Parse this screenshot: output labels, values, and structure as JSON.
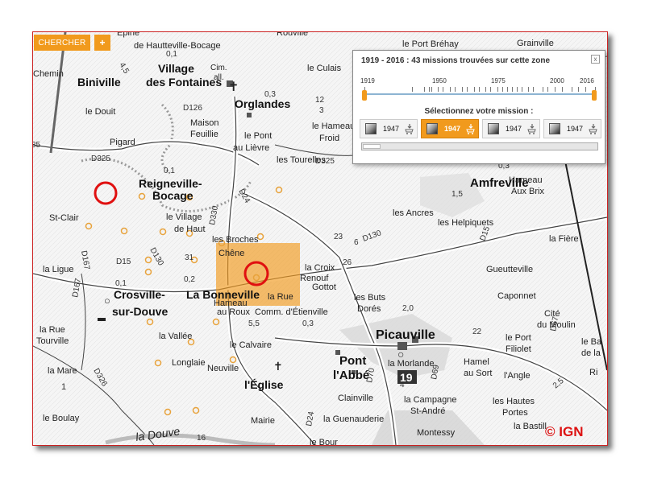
{
  "toolbar": {
    "search_label": "CHERCHER",
    "plus_label": "+"
  },
  "panel": {
    "title": "1919 - 2016 : 43 missions trouvées sur cette zone",
    "close_label": "x",
    "timeline_years": [
      "1919",
      "1950",
      "1975",
      "2000",
      "2016"
    ],
    "select_label": "Sélectionnez votre mission :",
    "missions": [
      {
        "year": "1947",
        "selected": false
      },
      {
        "year": "1947",
        "selected": true
      },
      {
        "year": "1947",
        "selected": false
      },
      {
        "year": "1947",
        "selected": false
      }
    ]
  },
  "map": {
    "places": [
      "Biniville",
      "Village des Fontaines",
      "Orglandes",
      "Reigneville- Bocage",
      "Crosville-sur-Douve",
      "La Bonneville",
      "Picauville",
      "Pont l'Abbé",
      "l'Église",
      "Amfreville"
    ],
    "labels": [
      "Épine",
      "de Hautteville-Bocage",
      "Rouville",
      "le Port Bréhay",
      "Grainville",
      "Chemin",
      "le Culais",
      "le Douit",
      "Maison Feuillie",
      "le Pont au Lièvre",
      "le Hameau Froid",
      "Pigard",
      "les Tourelles",
      "Hameau Aux Brix",
      "St-Clair",
      "le Village de Haut",
      "les Ancres",
      "les Helpiquets",
      "les Broches",
      "la Fière",
      "la Ligue",
      "Chêne",
      "la Croix Renouf",
      "Gottot",
      "Gueutteville",
      "Hameau",
      "la Rue",
      "Comm. d'Étienville",
      "Caponnet",
      "les Buts Dorés",
      "la Rue Tourville",
      "la Vallée",
      "Cité du Moulin",
      "le Port Filiolet",
      "le Calvaire",
      "la Morlande",
      "Hamel au Sort",
      "la Mare",
      "Longlaie",
      "Neuville",
      "l'Angle",
      "le Bas de la Ri",
      "Clainville",
      "la Campagne St-André",
      "les Hautes Portes",
      "le Boulay",
      "la Guenauderie",
      "la Bastille",
      "Mairie",
      "Montessy",
      "la Douve",
      "au Roux",
      "Cim. all.",
      "le Bour"
    ],
    "roads": [
      "D126",
      "D325",
      "D24",
      "D330",
      "D130",
      "D15",
      "D167",
      "D326",
      "D70",
      "D69",
      "D67"
    ],
    "numbers": [
      "0,1",
      "4,5",
      "0,3",
      "3",
      "12",
      "35",
      "6",
      "23",
      "26",
      "31",
      "0,2",
      "2,0",
      "22",
      "5,5",
      "0,3",
      "19",
      "4",
      "16",
      "1,5",
      "2,5",
      "1"
    ],
    "copyright": "© IGN"
  },
  "colors": {
    "accent": "#f19a1d",
    "circle": "#e01010",
    "frame_border": "#cc2222"
  }
}
